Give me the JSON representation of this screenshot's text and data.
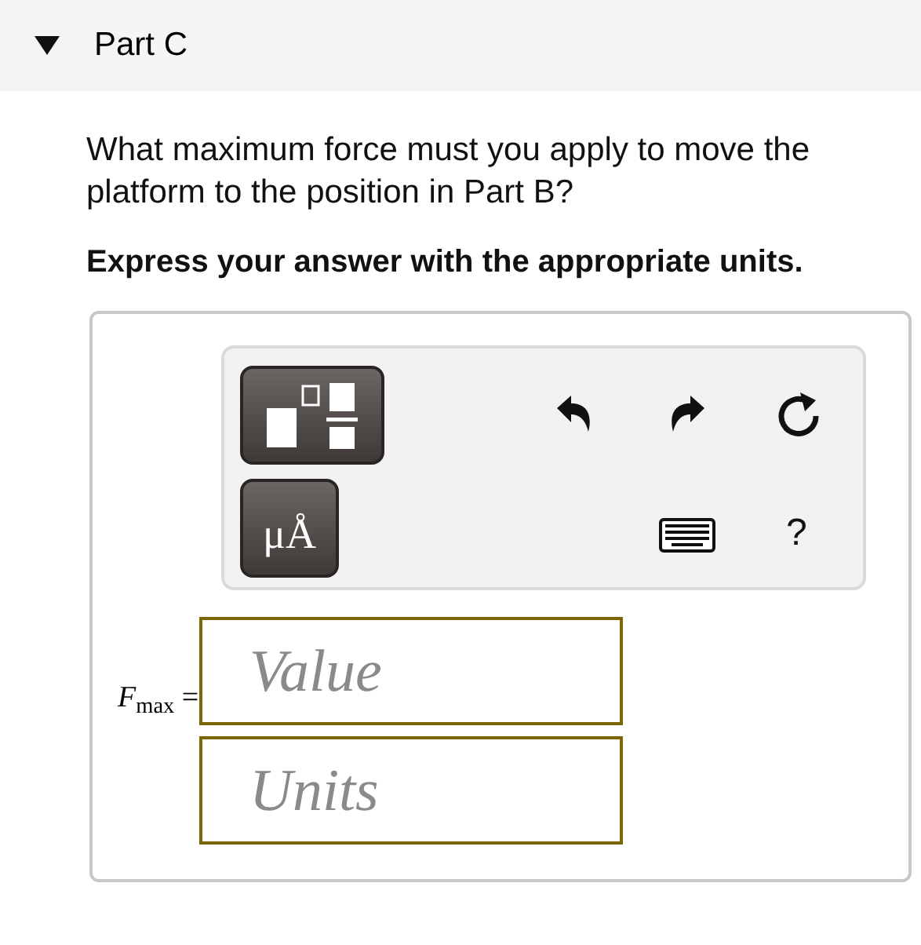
{
  "part": {
    "title": "Part C",
    "expanded": true
  },
  "question": "What maximum force must you apply to move the platform to the position in Part B?",
  "instruction": "Express your answer with the appropriate units.",
  "toolbar": {
    "units_button": "μÅ",
    "help": "?"
  },
  "answer": {
    "label": "*F*$_{max}$ =",
    "fields": [
      {
        "placeholder": "Value"
      },
      {
        "placeholder": "Units"
      }
    ]
  }
}
